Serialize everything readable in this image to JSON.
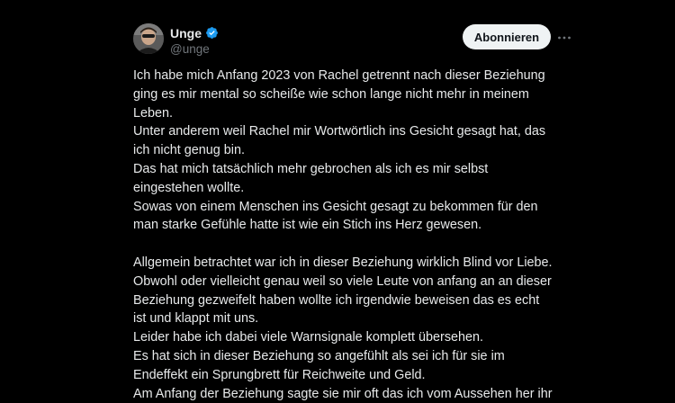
{
  "author": {
    "display_name": "Unge",
    "handle": "@unge",
    "verified": true,
    "avatar_icon": "profile-photo"
  },
  "actions": {
    "follow_label": "Abonnieren",
    "more_icon": "ellipsis-icon"
  },
  "tweet": {
    "lines": [
      "Ich habe mich Anfang 2023 von Rachel getrennt nach dieser Beziehung",
      "ging es mir mental so scheiße wie schon lange nicht mehr in meinem",
      "Leben.",
      "Unter anderem weil Rachel mir Wortwörtlich ins Gesicht gesagt hat, das",
      "ich nicht genug bin.",
      "Das hat mich tatsächlich mehr gebrochen als ich es mir selbst",
      "eingestehen wollte.",
      "Sowas von einem Menschen ins Gesicht gesagt zu bekommen für den",
      "man starke Gefühle hatte ist wie ein Stich ins Herz gewesen.",
      "",
      "Allgemein betrachtet war ich in dieser Beziehung wirklich Blind vor Liebe.",
      "Obwohl oder vielleicht genau weil so viele Leute von anfang an an dieser",
      "Beziehung gezweifelt haben wollte ich irgendwie beweisen das es echt",
      "ist und klappt mit uns.",
      "Leider habe ich dabei viele Warnsignale komplett übersehen.",
      "Es hat sich in dieser Beziehung so angefühlt als sei ich für sie im",
      "Endeffekt ein Sprungbrett für Reichweite und Geld.",
      "Am Anfang der Beziehung sagte sie mir oft das ich vom Aussehen her ihr"
    ]
  },
  "colors": {
    "background": "#000000",
    "text": "#e7e9ea",
    "secondary_text": "#71767b",
    "verified_badge": "#1d9bf0",
    "follow_button_bg": "#eff3f4"
  }
}
